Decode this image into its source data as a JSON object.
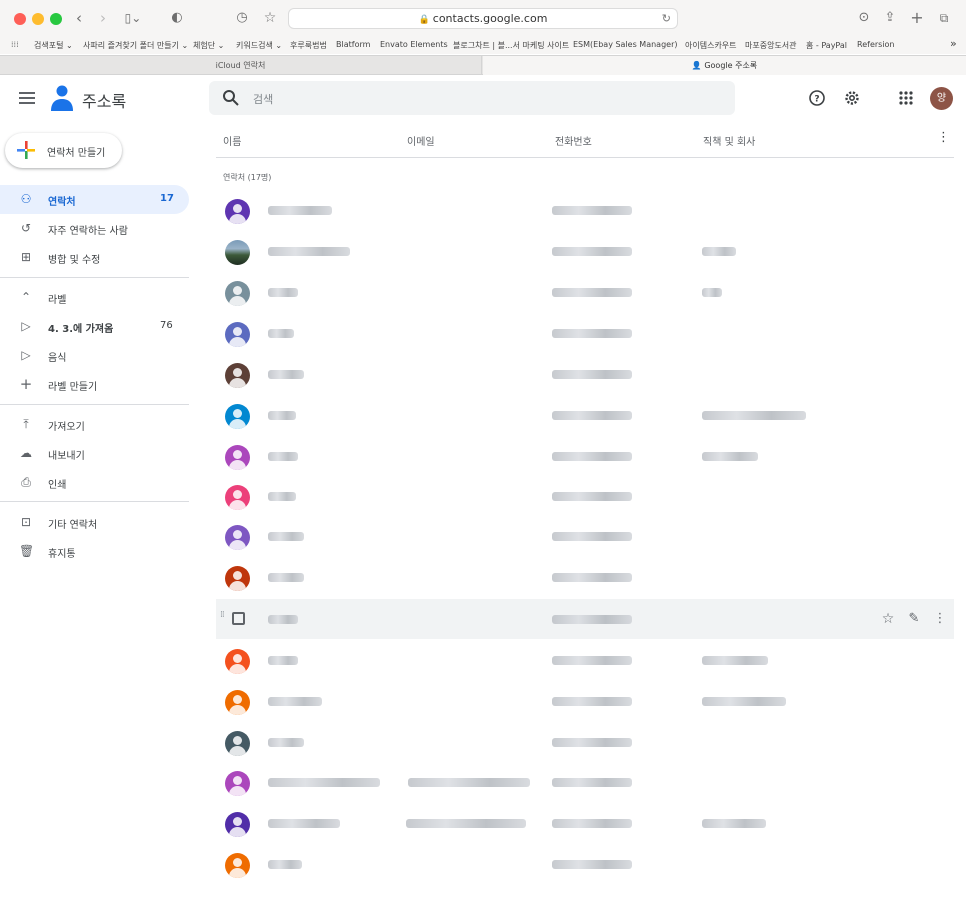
{
  "browser": {
    "url": "contacts.google.com",
    "bookmarks": [
      "검색포털 ⌄",
      "사파리 즐겨찾기 폴더 만들기 ⌄",
      "체험단 ⌄",
      "키워드검색 ⌄",
      "후루룩법법",
      "Blatform",
      "Envato Elements",
      "블로그차트 | 블...서 마케팅 사이트",
      "ESM(Ebay Sales Manager)",
      "아이템스카우트",
      "마포중앙도서관",
      "홈 - PayPal",
      "Refersion"
    ],
    "tabs": [
      {
        "label": "iCloud 연락처"
      },
      {
        "label": "Google 주소록"
      }
    ]
  },
  "app": {
    "title": "주소록",
    "search_placeholder": "검색",
    "user_initial": "양",
    "create_label": "연락처 만들기"
  },
  "nav": {
    "contacts": {
      "label": "연락처",
      "count": "17"
    },
    "frequent": {
      "label": "자주 연락하는 사람"
    },
    "merge": {
      "label": "병합 및 수정"
    },
    "labels_header": {
      "label": "라벨"
    },
    "label1": {
      "label": "4. 3.에 가져옴",
      "count": "76"
    },
    "label2": {
      "label": "음식"
    },
    "create_label": {
      "label": "라벨 만들기"
    },
    "import": {
      "label": "가져오기"
    },
    "export": {
      "label": "내보내기"
    },
    "print": {
      "label": "인쇄"
    },
    "other": {
      "label": "기타 연락처"
    },
    "trash": {
      "label": "휴지통"
    }
  },
  "table": {
    "headers": {
      "name": "이름",
      "email": "이메일",
      "phone": "전화번호",
      "job": "직책 및 회사"
    },
    "section_label": "연락처 (17명)"
  },
  "colors": {
    "accent": "#1967d2",
    "avatars": [
      "#5e35b1",
      "photo",
      "#78909c",
      "#5c6bc0",
      "#5d4037",
      "#0288d1",
      "#ab47bc",
      "#ec407a",
      "#7e57c2",
      "#bf360c",
      "none",
      "#f4511e",
      "#ef6c00",
      "#455a64",
      "#ab47bc",
      "#512da8",
      "#ef6c00"
    ]
  }
}
